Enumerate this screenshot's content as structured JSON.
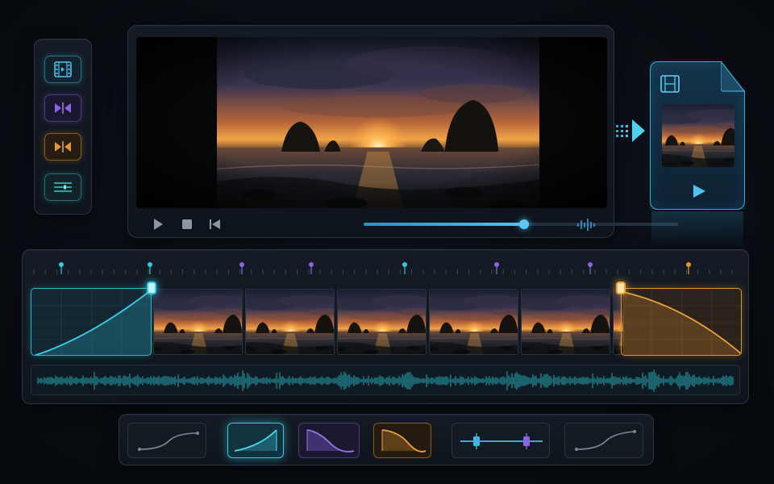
{
  "icons": {
    "tool_1": "film-icon",
    "tool_2": "split-merge-icon",
    "tool_3": "crossfade-icon",
    "tool_4": "sliders-icon",
    "play": "play-icon",
    "stop": "stop-icon",
    "skip_back": "skip-back-icon",
    "volume": "audio-meter-icon",
    "export": "export-arrow-icon",
    "file": "video-file-icon"
  },
  "colors": {
    "accent_cyan": "#38c6e0",
    "accent_violet": "#8a63e6",
    "accent_amber": "#e3962f"
  },
  "playback": {
    "progress": 0.51
  },
  "timeline": {
    "markers": [
      "cyan",
      "cyan",
      "violet",
      "violet",
      "cyan",
      "violet",
      "violet",
      "amber"
    ],
    "clip_count": 5
  },
  "presets": [
    {
      "curve": "s-curve",
      "state": "default"
    },
    {
      "curve": "linear-ramp-up",
      "state": "active"
    },
    {
      "curve": "ease-out-fall",
      "state": "violet"
    },
    {
      "curve": "ease-in-fall",
      "state": "amber"
    },
    {
      "curve": "dual-slider",
      "state": "default"
    },
    {
      "curve": "s-curve",
      "state": "default"
    }
  ]
}
